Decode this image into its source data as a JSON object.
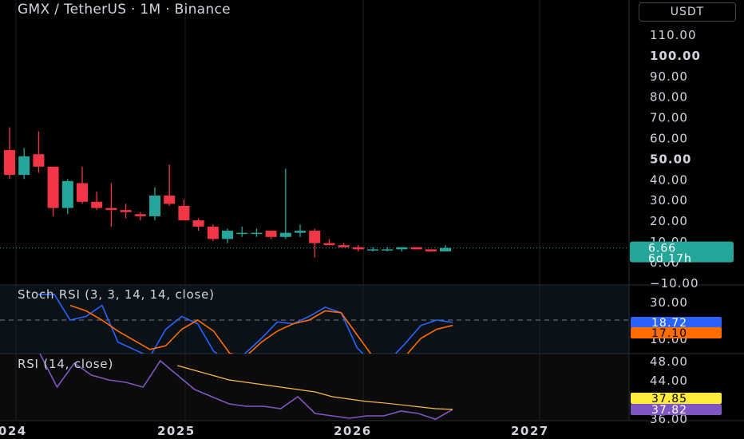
{
  "header": {
    "title": "GMX / TetherUS · 1M · Binance",
    "currency": "USDT"
  },
  "colors": {
    "up": "#26a69a",
    "down": "#f23645",
    "k_line": "#2962ff",
    "d_line": "#ff6d00",
    "rsi_line": "#7e57c2",
    "rsi_ma": "#ffb74d",
    "text": "#d1d4dc",
    "bg": "#000000",
    "grid": "#1f1f1f"
  },
  "price_badge": {
    "price": "6.66",
    "countdown": "6d 17h"
  },
  "stoch_label": "Stoch RSI (3, 3, 14, 14, close)",
  "rsi_label": "RSI (14, close)",
  "stoch_badges": {
    "k": "18.72",
    "d": "17.10"
  },
  "rsi_badges": {
    "ma": "37.85",
    "rsi": "37.82"
  },
  "chart_data": [
    {
      "type": "candlestick",
      "title": "GMX / TetherUS · 1M · Binance",
      "y_ticks": [
        "110.00",
        "100.00",
        "90.00",
        "80.00",
        "70.00",
        "60.00",
        "50.00",
        "40.00",
        "30.00",
        "20.00",
        "10.00",
        "0.00",
        "−10.00"
      ],
      "y_bold": [
        "100.00",
        "50.00"
      ],
      "ylim": [
        -10,
        115
      ],
      "x_labels": [
        "2024",
        "2025",
        "2026",
        "2027"
      ],
      "candles": [
        {
          "o": 54,
          "h": 65,
          "l": 40,
          "c": 42
        },
        {
          "o": 42,
          "h": 55,
          "l": 40,
          "c": 51
        },
        {
          "o": 52,
          "h": 63,
          "l": 43,
          "c": 46
        },
        {
          "o": 46,
          "h": 46,
          "l": 22,
          "c": 26
        },
        {
          "o": 26,
          "h": 40,
          "l": 23,
          "c": 39
        },
        {
          "o": 38,
          "h": 46,
          "l": 28,
          "c": 29
        },
        {
          "o": 29,
          "h": 34,
          "l": 25,
          "c": 26
        },
        {
          "o": 26,
          "h": 38,
          "l": 17,
          "c": 25
        },
        {
          "o": 25,
          "h": 28,
          "l": 21,
          "c": 24
        },
        {
          "o": 23,
          "h": 24,
          "l": 20,
          "c": 22
        },
        {
          "o": 22,
          "h": 36,
          "l": 20,
          "c": 32
        },
        {
          "o": 32,
          "h": 47,
          "l": 27,
          "c": 28
        },
        {
          "o": 27,
          "h": 30,
          "l": 20,
          "c": 20
        },
        {
          "o": 20,
          "h": 21,
          "l": 15,
          "c": 17
        },
        {
          "o": 17,
          "h": 18,
          "l": 10,
          "c": 11
        },
        {
          "o": 11,
          "h": 16,
          "l": 9,
          "c": 15
        },
        {
          "o": 14,
          "h": 17,
          "l": 12,
          "c": 14
        },
        {
          "o": 14,
          "h": 16,
          "l": 12,
          "c": 14
        },
        {
          "o": 15,
          "h": 15,
          "l": 11,
          "c": 12
        },
        {
          "o": 12,
          "h": 45,
          "l": 11,
          "c": 14
        },
        {
          "o": 14,
          "h": 18,
          "l": 12,
          "c": 15
        },
        {
          "o": 15,
          "h": 16,
          "l": 2,
          "c": 9
        },
        {
          "o": 9,
          "h": 11,
          "l": 8,
          "c": 8
        },
        {
          "o": 8,
          "h": 9,
          "l": 7,
          "c": 7
        },
        {
          "o": 7,
          "h": 8,
          "l": 5,
          "c": 6
        },
        {
          "o": 6,
          "h": 7,
          "l": 5,
          "c": 6
        },
        {
          "o": 6,
          "h": 7,
          "l": 5,
          "c": 6
        },
        {
          "o": 6,
          "h": 7,
          "l": 5,
          "c": 7
        },
        {
          "o": 7,
          "h": 7,
          "l": 6,
          "c": 6
        },
        {
          "o": 6,
          "h": 6,
          "l": 5,
          "c": 5
        },
        {
          "o": 5,
          "h": 8,
          "l": 5,
          "c": 6.66
        }
      ],
      "last_price": 6.66
    },
    {
      "type": "line",
      "title": "Stoch RSI (3, 3, 14, 14, close)",
      "y_ticks": [
        "30.00",
        "10.00"
      ],
      "ylim": [
        0,
        35
      ],
      "reference_line": 20,
      "series": [
        {
          "name": "K",
          "values": [
            34,
            34,
            20,
            22,
            28,
            8,
            4,
            0,
            15,
            22,
            18,
            3,
            -3,
            2,
            10,
            19,
            18,
            22,
            27,
            24,
            5,
            -4,
            -2,
            7,
            17,
            20,
            18.72
          ]
        },
        {
          "name": "D",
          "values": [
            null,
            null,
            28,
            25,
            20,
            14,
            9,
            4,
            6,
            15,
            20,
            14,
            2,
            0,
            8,
            14,
            18,
            20,
            25,
            24,
            12,
            0,
            -4,
            0,
            10,
            15,
            17.1
          ]
        }
      ]
    },
    {
      "type": "line",
      "title": "RSI (14, close)",
      "y_ticks": [
        "48.00",
        "44.00",
        "36.00"
      ],
      "ylim": [
        35.5,
        50
      ],
      "series": [
        {
          "name": "RSI",
          "values": [
            49.5,
            42.5,
            47.5,
            45,
            44,
            43.5,
            42.5,
            48,
            45,
            42,
            40.5,
            39,
            38.5,
            38.5,
            38,
            40.5,
            37,
            36.5,
            36,
            36.5,
            36.5,
            37.5,
            37,
            35.8,
            37.82
          ]
        },
        {
          "name": "RSI MA",
          "values": [
            null,
            null,
            null,
            null,
            null,
            null,
            null,
            null,
            47,
            46,
            45,
            44,
            43.5,
            43,
            42.5,
            42,
            41.5,
            40.5,
            40,
            39.5,
            39.2,
            38.8,
            38.4,
            38,
            37.85
          ]
        }
      ]
    }
  ]
}
